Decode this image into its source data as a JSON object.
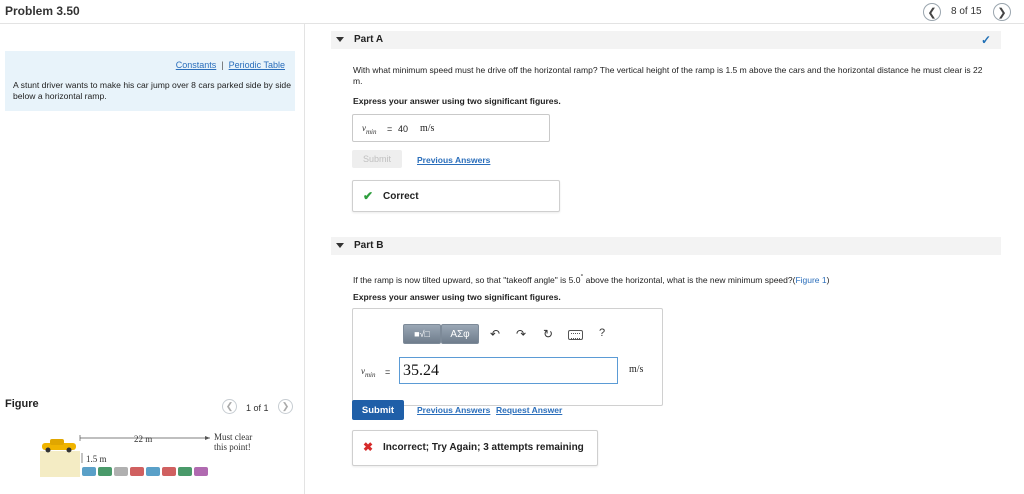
{
  "header": {
    "title": "Problem 3.50",
    "position": "8 of 15",
    "prev_icon": "chevron-left-icon",
    "next_icon": "chevron-right-icon"
  },
  "left": {
    "links": {
      "constants": "Constants",
      "separator": "|",
      "periodic": "Periodic Table"
    },
    "intro": "A stunt driver wants to make his car jump over 8 cars parked side by side below a horizontal ramp.",
    "figure": {
      "label": "Figure",
      "count": "1 of 1",
      "distance": "22 m",
      "height": "1.5 m",
      "note_line1": "Must clear",
      "note_line2": "this point!"
    }
  },
  "partA": {
    "title": "Part A",
    "status_icon": "checkmark-icon",
    "question": "With what minimum speed must he drive off the horizontal ramp? The vertical height of the ramp is 1.5 m above the cars and the horizontal distance he must clear is 22 m.",
    "instruction": "Express your answer using two significant figures.",
    "var_symbol": "v",
    "var_sub": "min",
    "equals": "=",
    "answer": "40",
    "unit": "m/s",
    "submit": "Submit",
    "previous": "Previous Answers",
    "feedback": "Correct"
  },
  "partB": {
    "title": "Part B",
    "question_pre": "If the ramp is now tilted upward, so that \"takeoff angle\" is 5.0",
    "question_deg": "°",
    "question_post": " above the horizontal, what is the new minimum speed?(",
    "figure_link": "Figure 1",
    "question_end": ")",
    "instruction": "Express your answer using two significant figures.",
    "toolbar": {
      "templates_icon": "templates-icon",
      "greek": "ΑΣφ",
      "undo_icon": "undo-icon",
      "redo_icon": "redo-icon",
      "reset_icon": "reset-icon",
      "keyboard_icon": "keyboard-icon",
      "help": "?"
    },
    "var_symbol": "v",
    "var_sub": "min",
    "equals": "=",
    "answer": "35.24",
    "unit": "m/s",
    "submit": "Submit",
    "previous": "Previous Answers",
    "request": "Request Answer",
    "feedback": "Incorrect; Try Again; 3 attempts remaining"
  },
  "colors": {
    "accent": "#1f5fa8",
    "link": "#2a6ebb",
    "correct": "#2e9e3e",
    "incorrect": "#d62a2a",
    "intro_bg": "#e8f3fa"
  }
}
